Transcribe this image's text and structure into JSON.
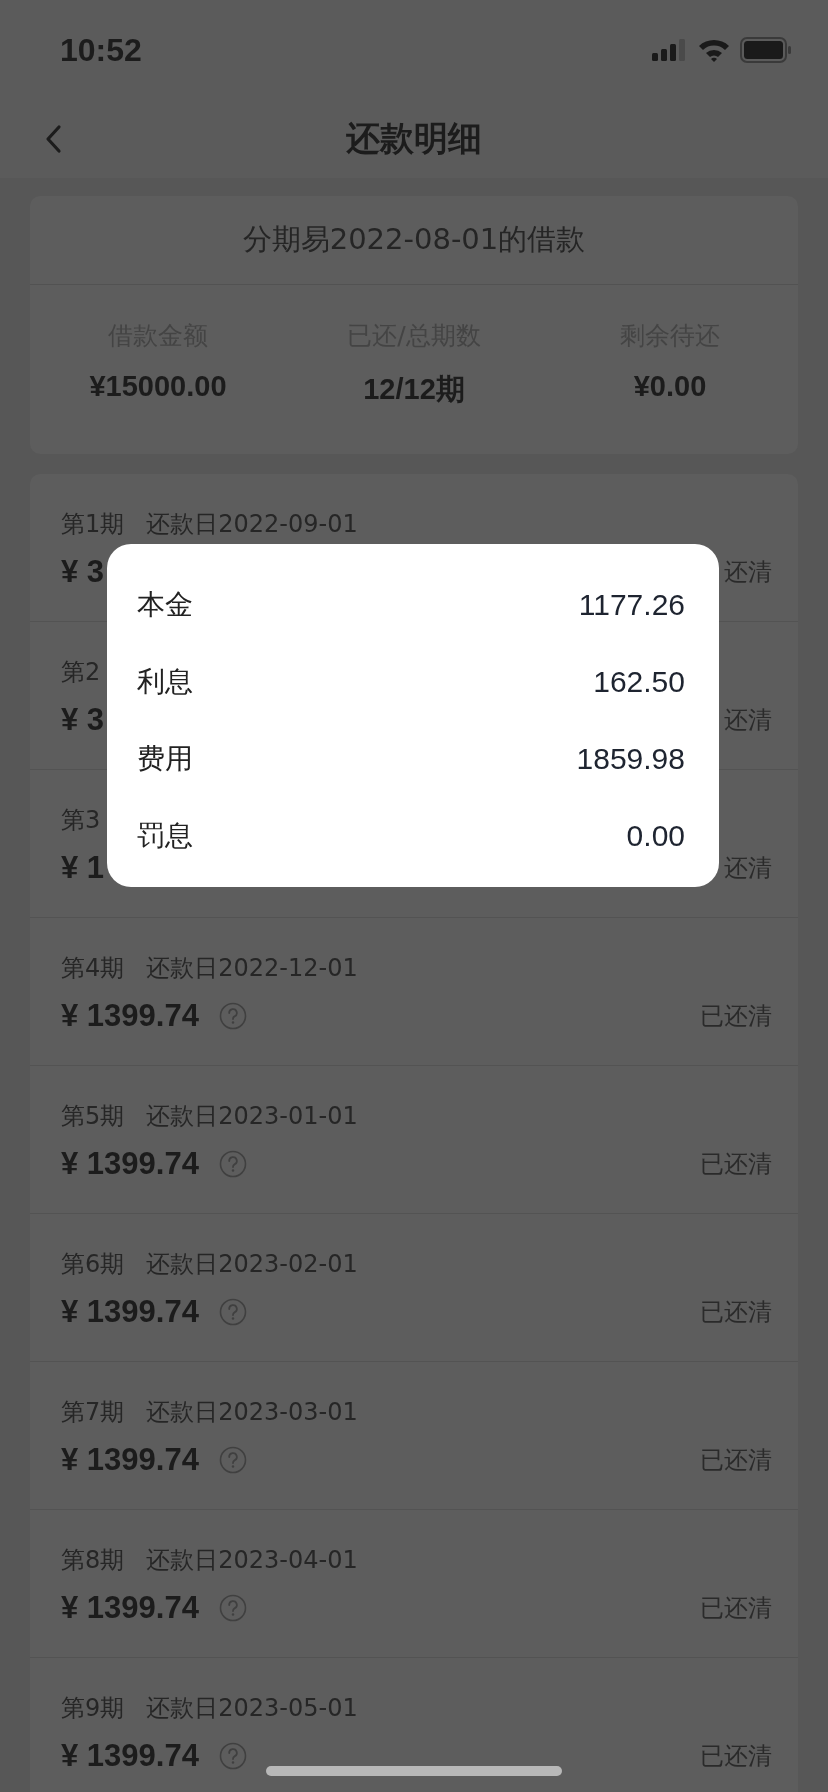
{
  "status_bar": {
    "time": "10:52"
  },
  "nav": {
    "title": "还款明细"
  },
  "loan": {
    "title": "分期易2022-08-01的借款",
    "stats": [
      {
        "label": "借款金额",
        "value": "¥15000.00"
      },
      {
        "label": "已还/总期数",
        "value": "12/12期"
      },
      {
        "label": "剩余待还",
        "value": "¥0.00"
      }
    ]
  },
  "installments": [
    {
      "period": "第1期",
      "due": "还款日2022-09-01",
      "amount": "¥ 3",
      "help_icon": false,
      "status": "还清"
    },
    {
      "period": "第2",
      "amount": "¥ 3",
      "help_icon": false,
      "status": "还清"
    },
    {
      "period": "第3",
      "amount": "¥ 1",
      "help_icon": false,
      "status": "还清"
    },
    {
      "period": "第4期",
      "due": "还款日2022-12-01",
      "amount": "¥ 1399.74",
      "help_icon": true,
      "status": "已还清"
    },
    {
      "period": "第5期",
      "due": "还款日2023-01-01",
      "amount": "¥ 1399.74",
      "help_icon": true,
      "status": "已还清"
    },
    {
      "period": "第6期",
      "due": "还款日2023-02-01",
      "amount": "¥ 1399.74",
      "help_icon": true,
      "status": "已还清"
    },
    {
      "period": "第7期",
      "due": "还款日2023-03-01",
      "amount": "¥ 1399.74",
      "help_icon": true,
      "status": "已还清"
    },
    {
      "period": "第8期",
      "due": "还款日2023-04-01",
      "amount": "¥ 1399.74",
      "help_icon": true,
      "status": "已还清"
    },
    {
      "period": "第9期",
      "due": "还款日2023-05-01",
      "amount": "¥ 1399.74",
      "help_icon": true,
      "status": "已还清"
    }
  ],
  "breakdown": [
    {
      "label": "本金",
      "value": "1177.26"
    },
    {
      "label": "利息",
      "value": "162.50"
    },
    {
      "label": "费用",
      "value": "1859.98"
    },
    {
      "label": "罚息",
      "value": "0.00"
    }
  ]
}
